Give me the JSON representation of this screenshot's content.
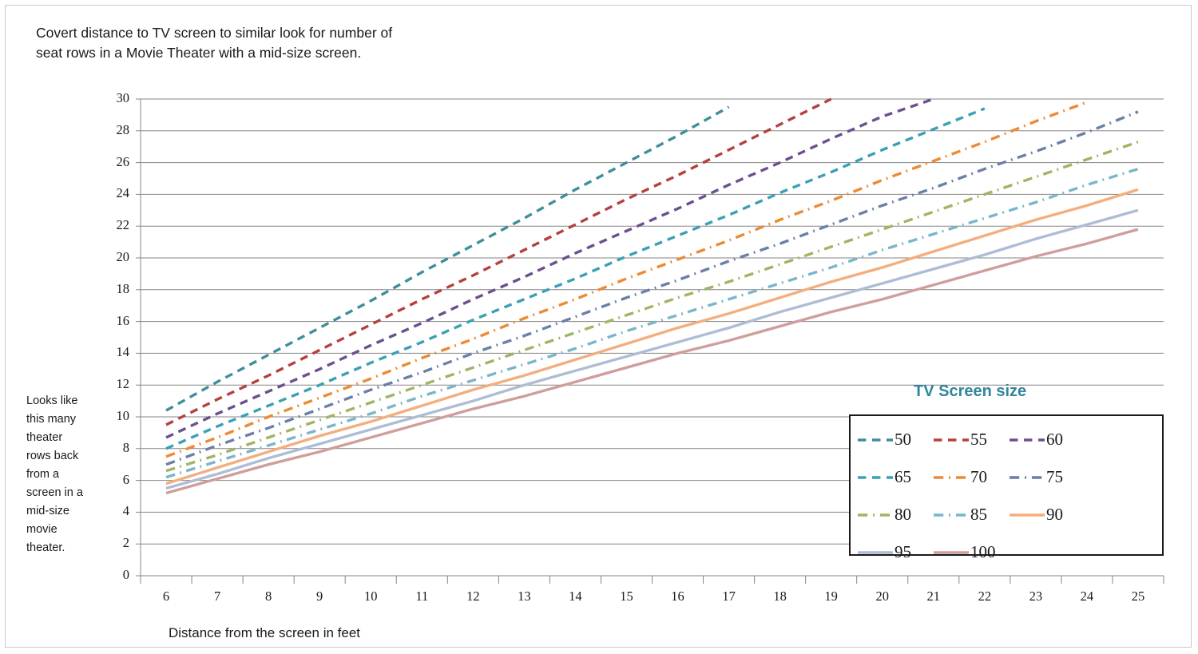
{
  "chart_title": "Covert distance to TV screen to similar look for number of seat rows in a Movie Theater with a mid-size screen.",
  "left_note": "Looks like this many theater rows back from a screen in a mid-size movie theater.",
  "x_axis_title": "Distance from the screen in feet",
  "legend_title": "TV Screen size",
  "legend": [
    {
      "label": "50",
      "color": "#3f8e9b",
      "style": "dashed"
    },
    {
      "label": "55",
      "color": "#b5413c",
      "style": "dashed"
    },
    {
      "label": "60",
      "color": "#6b4f8f",
      "style": "dashed"
    },
    {
      "label": "65",
      "color": "#3aa0b5",
      "style": "dashed"
    },
    {
      "label": "70",
      "color": "#ed8a33",
      "style": "dashdot"
    },
    {
      "label": "75",
      "color": "#6b7fa8",
      "style": "dashdot"
    },
    {
      "label": "80",
      "color": "#a2b464",
      "style": "dashdot"
    },
    {
      "label": "85",
      "color": "#79b6c9",
      "style": "dashdot"
    },
    {
      "label": "90",
      "color": "#f4ae7e",
      "style": "solid"
    },
    {
      "label": "95",
      "color": "#adbdd4",
      "style": "solid"
    },
    {
      "label": "100",
      "color": "#cf9e9b",
      "style": "solid"
    }
  ],
  "chart_data": {
    "type": "line",
    "title": "Covert distance to TV screen to similar look for number of seat rows in a Movie Theater with a mid-size screen.",
    "xlabel": "Distance from the screen in feet",
    "ylabel": "Looks like this many theater rows back from a screen in a mid-size movie theater.",
    "legend_title": "TV Screen size",
    "legend_position": "inside-right",
    "grid": true,
    "xlim": [
      6,
      25
    ],
    "ylim": [
      0,
      30
    ],
    "xticks": [
      6,
      7,
      8,
      9,
      10,
      11,
      12,
      13,
      14,
      15,
      16,
      17,
      18,
      19,
      20,
      21,
      22,
      23,
      24,
      25
    ],
    "yticks": [
      0,
      2,
      4,
      6,
      8,
      10,
      12,
      14,
      16,
      18,
      20,
      22,
      24,
      26,
      28,
      30
    ],
    "x": [
      6,
      7,
      8,
      9,
      10,
      11,
      12,
      13,
      14,
      15,
      16,
      17,
      18,
      19,
      20,
      21,
      22,
      23,
      24,
      25
    ],
    "series": [
      {
        "name": "50",
        "color": "#3f8e9b",
        "style": "dashed",
        "values": [
          10.4,
          12.2,
          13.9,
          15.6,
          17.3,
          19.1,
          20.8,
          22.5,
          24.3,
          26.0,
          27.7,
          29.5,
          null,
          null,
          null,
          null,
          null,
          null,
          null,
          null
        ]
      },
      {
        "name": "55",
        "color": "#b5413c",
        "style": "dashed",
        "values": [
          9.5,
          11.1,
          12.6,
          14.2,
          15.8,
          17.4,
          18.9,
          20.5,
          22.1,
          23.7,
          25.2,
          26.8,
          28.4,
          30.0,
          null,
          null,
          null,
          null,
          null,
          null
        ]
      },
      {
        "name": "60",
        "color": "#6b4f8f",
        "style": "dashed",
        "values": [
          8.7,
          10.2,
          11.6,
          13.0,
          14.5,
          15.9,
          17.4,
          18.8,
          20.3,
          21.7,
          23.1,
          24.6,
          26.0,
          27.5,
          28.9,
          30.0,
          null,
          null,
          null,
          null
        ]
      },
      {
        "name": "65",
        "color": "#3aa0b5",
        "style": "dashed",
        "values": [
          8.0,
          9.4,
          10.7,
          12.0,
          13.4,
          14.7,
          16.1,
          17.4,
          18.7,
          20.1,
          21.4,
          22.7,
          24.1,
          25.4,
          26.8,
          28.1,
          29.4,
          null,
          null,
          null
        ]
      },
      {
        "name": "70",
        "color": "#ed8a33",
        "style": "dashdot",
        "values": [
          7.5,
          8.7,
          10.0,
          11.2,
          12.4,
          13.7,
          14.9,
          16.2,
          17.4,
          18.7,
          19.9,
          21.1,
          22.4,
          23.6,
          24.9,
          26.1,
          27.3,
          28.6,
          29.8,
          null
        ]
      },
      {
        "name": "75",
        "color": "#6b7fa8",
        "style": "dashdot",
        "values": [
          7.0,
          8.2,
          9.3,
          10.5,
          11.7,
          12.8,
          14.0,
          15.1,
          16.3,
          17.5,
          18.6,
          19.8,
          20.9,
          22.1,
          23.3,
          24.4,
          25.6,
          26.7,
          27.9,
          29.2
        ]
      },
      {
        "name": "80",
        "color": "#a2b464",
        "style": "dashdot",
        "values": [
          6.6,
          7.6,
          8.7,
          9.8,
          10.9,
          12.0,
          13.1,
          14.2,
          15.3,
          16.4,
          17.5,
          18.5,
          19.6,
          20.7,
          21.8,
          22.9,
          24.0,
          25.1,
          26.2,
          27.3
        ]
      },
      {
        "name": "85",
        "color": "#79b6c9",
        "style": "dashdot",
        "values": [
          6.2,
          7.2,
          8.2,
          9.2,
          10.2,
          11.3,
          12.3,
          13.3,
          14.3,
          15.4,
          16.4,
          17.4,
          18.4,
          19.4,
          20.5,
          21.5,
          22.5,
          23.5,
          24.6,
          25.6
        ]
      },
      {
        "name": "90",
        "color": "#f4ae7e",
        "style": "solid",
        "values": [
          5.8,
          6.8,
          7.8,
          8.8,
          9.7,
          10.7,
          11.7,
          12.6,
          13.6,
          14.6,
          15.6,
          16.5,
          17.5,
          18.5,
          19.4,
          20.4,
          21.4,
          22.4,
          23.3,
          24.3
        ]
      },
      {
        "name": "95",
        "color": "#adbdd4",
        "style": "solid",
        "values": [
          5.5,
          6.4,
          7.4,
          8.3,
          9.2,
          10.1,
          11.0,
          12.0,
          12.9,
          13.8,
          14.7,
          15.6,
          16.6,
          17.5,
          18.4,
          19.3,
          20.2,
          21.2,
          22.1,
          23.0
        ]
      },
      {
        "name": "100",
        "color": "#cf9e9b",
        "style": "solid",
        "values": [
          5.2,
          6.1,
          7.0,
          7.8,
          8.7,
          9.6,
          10.5,
          11.3,
          12.2,
          13.1,
          14.0,
          14.8,
          15.7,
          16.6,
          17.4,
          18.3,
          19.2,
          20.1,
          20.9,
          21.8
        ]
      }
    ]
  }
}
